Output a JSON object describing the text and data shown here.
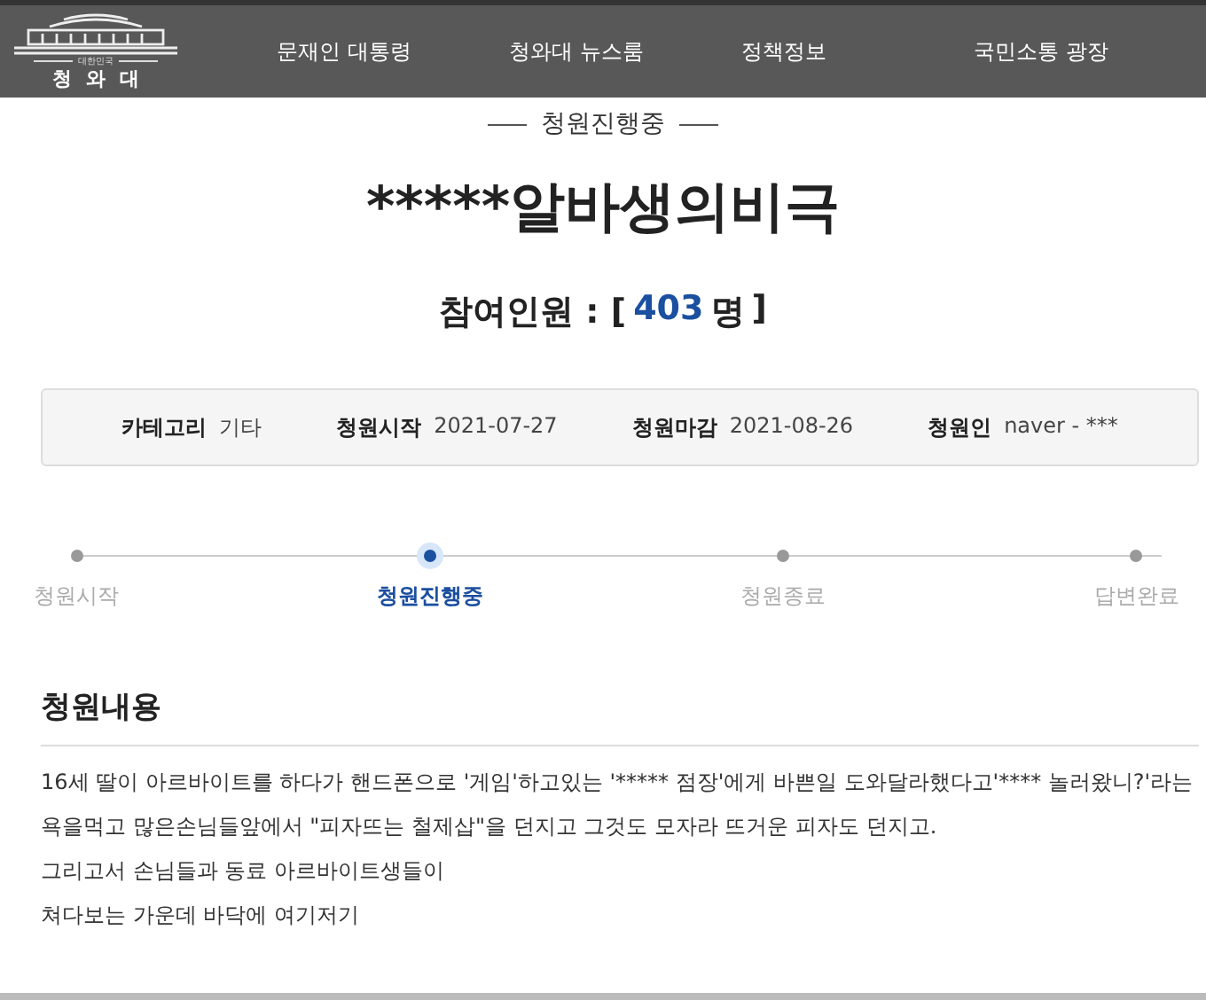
{
  "header": {
    "logo": {
      "subtitle": "대한민국",
      "title": "청와대"
    },
    "nav": [
      "문재인 대통령",
      "청와대 뉴스룸",
      "정책정보",
      "국민소통 광장"
    ]
  },
  "status_label": "청원진행중",
  "title": "*****알바생의비극",
  "participants": {
    "label": "참여인원 : [",
    "count": "403",
    "unit": "명",
    "close": "]"
  },
  "info": [
    {
      "label": "카테고리",
      "value": "기타"
    },
    {
      "label": "청원시작",
      "value": "2021-07-27"
    },
    {
      "label": "청원마감",
      "value": "2021-08-26"
    },
    {
      "label": "청원인",
      "value": "naver - ***"
    }
  ],
  "steps": [
    {
      "label": "청원시작",
      "selected": false
    },
    {
      "label": "청원진행중",
      "selected": true
    },
    {
      "label": "청원종료",
      "selected": false
    },
    {
      "label": "답변완료",
      "selected": false
    }
  ],
  "content": {
    "heading": "청원내용",
    "paragraphs": [
      "16세 딸이 아르바이트를 하다가 핸드폰으로 '게임'하고있는 '***** 점장'에게 바쁜일 도와달라했다고'**** 놀러왔니?'라는 욕을먹고 많은손님들앞에서 \"피자뜨는 철제삽\"을 던지고 그것도 모자라 뜨거운 피자도 던지고.",
      "그리고서 손님들과 동료 아르바이트생들이",
      "쳐다보는 가운데 바닥에 여기저기"
    ]
  }
}
